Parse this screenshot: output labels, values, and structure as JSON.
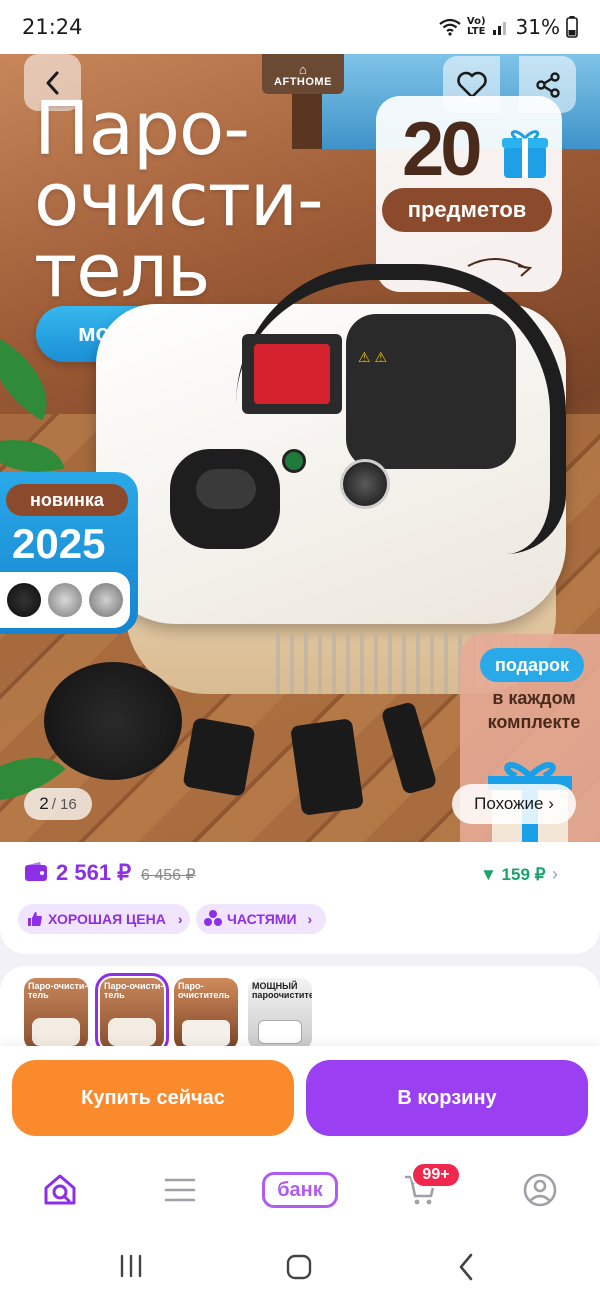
{
  "status_bar": {
    "time": "21:24",
    "network_top": "Vo)",
    "network_bottom": "LTE",
    "battery": "31%"
  },
  "product_image": {
    "brand": "AFTHOME",
    "title_lines": [
      "Паро-",
      "очисти-",
      "тель"
    ],
    "power_label": "мощный",
    "items_count": "20",
    "items_label": "предметов",
    "new_label": "новинка",
    "new_year": "2025",
    "gift_label": "подарок",
    "gift_text": "в каждом комплекте",
    "image_index": "2",
    "image_total": "/ 16",
    "similar_label": "Похожие ›"
  },
  "price": {
    "current": "2 561 ₽",
    "old": "6 456 ₽",
    "diff": "▼ 159 ₽",
    "tags": [
      "ХОРОШАЯ ЦЕНА",
      "ЧАСТЯМИ"
    ]
  },
  "thumbnails": [
    {
      "title": "Паро-очисти-тель",
      "active": false
    },
    {
      "title": "Паро-очисти-тель",
      "active": true
    },
    {
      "title": "Паро-очиститель",
      "active": false
    },
    {
      "title": "МОЩНЫЙ пароочиститель",
      "active": false
    }
  ],
  "actions": {
    "buy_now": "Купить сейчас",
    "add_to_cart": "В корзину"
  },
  "bottom_nav": {
    "bank_label": "банк",
    "cart_badge": "99+"
  },
  "colors": {
    "accent": "#8d2fe6",
    "buy_now": "#fb8a2d",
    "cart": "#9a3ff1",
    "discount_green": "#1aa46a",
    "badge_red": "#f0284e"
  },
  "icons": [
    "back-icon",
    "heart-icon",
    "share-icon",
    "gift-icon",
    "wallet-icon",
    "thumbs-up-icon",
    "parts-icon",
    "home-search-icon",
    "menu-icon",
    "cart-icon",
    "profile-icon"
  ]
}
